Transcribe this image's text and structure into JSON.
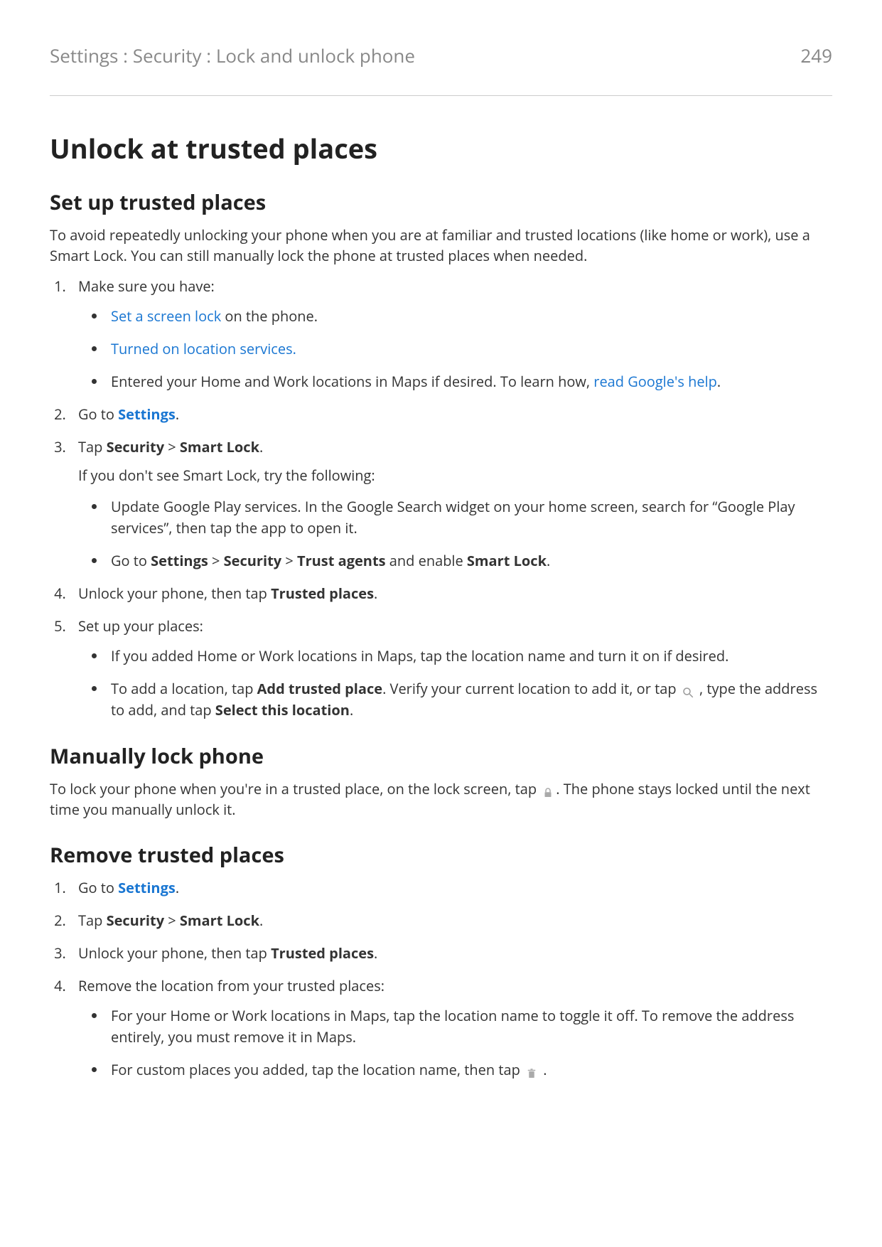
{
  "header": {
    "breadcrumb": "Settings : Security : Lock and unlock phone",
    "page_number": "249"
  },
  "title": "Unlock at trusted places",
  "section1": {
    "heading": "Set up trusted places",
    "intro": "To avoid repeatedly unlocking your phone when you are at familiar and trusted locations (like home or work), use a Smart Lock. You can still manually lock the phone at trusted places when needed.",
    "step1": {
      "text": "Make sure you have:",
      "bullets": {
        "b1_link": "Set a screen lock",
        "b1_rest": " on the phone.",
        "b2_link": "Turned on location services.",
        "b3_before": "Entered your Home and Work locations in Maps if desired. To learn how, ",
        "b3_link": "read Google's help",
        "b3_after": "."
      }
    },
    "step2": {
      "before": "Go to ",
      "link": "Settings",
      "after": "."
    },
    "step3": {
      "before": "Tap ",
      "bold1": "Security",
      "sep": " > ",
      "bold2": "Smart Lock",
      "after": ".",
      "note": "If you don't see Smart Lock, try the following:",
      "bullets": {
        "b1": "Update Google Play services. In the Google Search widget on your home screen, search for “Google Play services”, then tap the app to open it.",
        "b2_before": "Go to ",
        "b2_b1": "Settings",
        "b2_sep1": " > ",
        "b2_b2": "Security",
        "b2_sep2": " > ",
        "b2_b3": "Trust agents",
        "b2_mid": " and enable ",
        "b2_b4": "Smart Lock",
        "b2_after": "."
      }
    },
    "step4": {
      "before": "Unlock your phone, then tap ",
      "bold": "Trusted places",
      "after": "."
    },
    "step5": {
      "text": "Set up your places:",
      "bullets": {
        "b1": "If you added Home or Work locations in Maps, tap the location name and turn it on if desired.",
        "b2_before": "To add a location, tap ",
        "b2_bold1": "Add trusted place",
        "b2_mid1": ". Verify your current location to add it, or tap ",
        "b2_mid2": " , type the address to add, and tap ",
        "b2_bold2": "Select this location",
        "b2_after": "."
      }
    }
  },
  "section2": {
    "heading": "Manually lock phone",
    "para_before": "To lock your phone when you're in a trusted place, on the lock screen, tap ",
    "para_after": ". The phone stays locked until the next time you manually unlock it."
  },
  "section3": {
    "heading": "Remove trusted places",
    "step1": {
      "before": "Go to ",
      "link": "Settings",
      "after": "."
    },
    "step2": {
      "before": "Tap ",
      "bold1": "Security",
      "sep": " > ",
      "bold2": "Smart Lock",
      "after": "."
    },
    "step3": {
      "before": "Unlock your phone, then tap ",
      "bold": "Trusted places",
      "after": "."
    },
    "step4": {
      "text": "Remove the location from your trusted places:",
      "bullets": {
        "b1": "For your Home or Work locations in Maps, tap the location name to toggle it off. To remove the address entirely, you must remove it in Maps.",
        "b2_before": "For custom places you added, tap the location name, then tap ",
        "b2_after": " ."
      }
    }
  }
}
